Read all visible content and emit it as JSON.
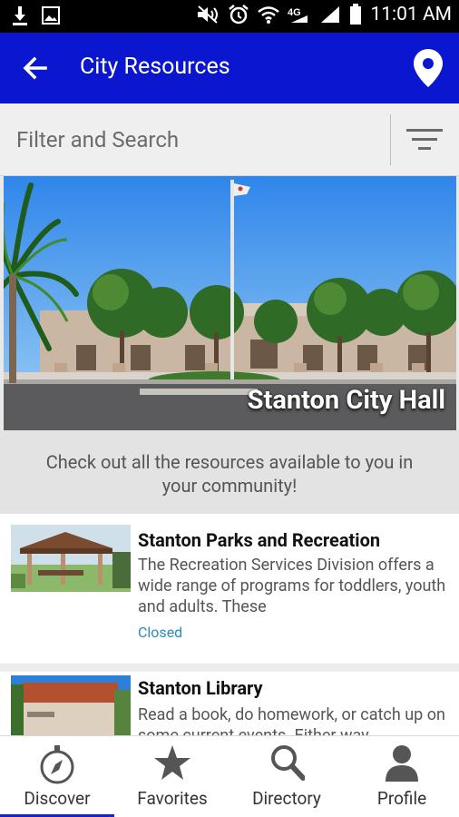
{
  "status_bar": {
    "time": "11:01 AM"
  },
  "app_bar": {
    "title": "City Resources"
  },
  "search": {
    "placeholder": "Filter and Search"
  },
  "hero": {
    "caption": "Stanton City Hall"
  },
  "intro": {
    "text": "Check out all the resources available to you in your community!"
  },
  "resources": [
    {
      "title": "Stanton Parks and Recreation",
      "description": "The Recreation Services Division offers a wide range of programs for toddlers, youth and adults. These",
      "status": "Closed"
    },
    {
      "title": "Stanton Library",
      "description": "Read a book, do homework, or catch up on some current events. Either way"
    }
  ],
  "bottom_nav": {
    "tabs": [
      {
        "label": "Discover",
        "icon": "compass-icon",
        "active": true
      },
      {
        "label": "Favorites",
        "icon": "star-icon"
      },
      {
        "label": "Directory",
        "icon": "search-icon"
      },
      {
        "label": "Profile",
        "icon": "person-icon"
      }
    ]
  },
  "colors": {
    "app_bar": "#0b16cf",
    "status_link": "#2a8bb7"
  }
}
